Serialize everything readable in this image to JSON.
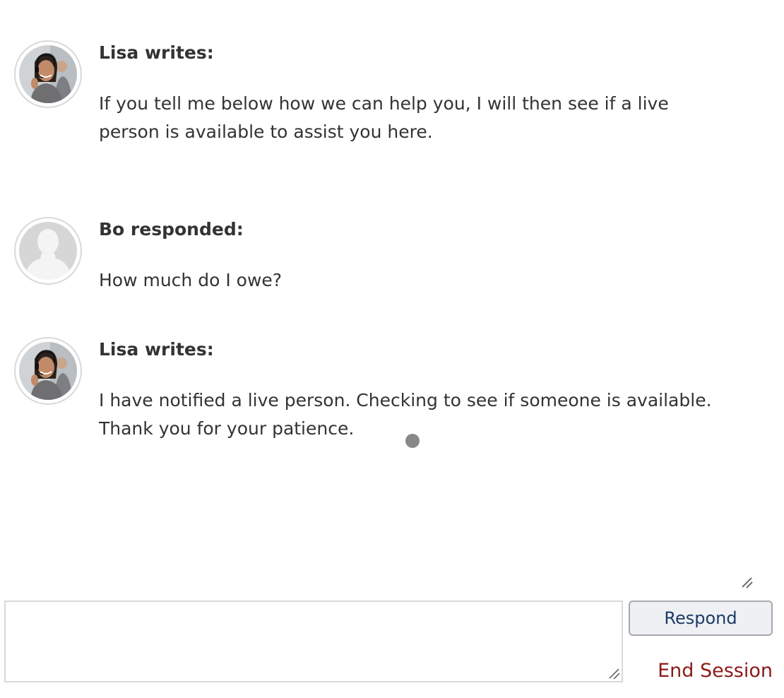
{
  "conversation": {
    "messages": [
      {
        "author": "Lisa writes:",
        "avatar": "agent-headset-photo",
        "text": "If you tell me below how we can help you, I will then see if a live person is available to assist you here."
      },
      {
        "author": "Bo responded:",
        "avatar": "default-user-silhouette",
        "text": "How much do I owe?"
      },
      {
        "author": "Lisa writes:",
        "avatar": "agent-headset-photo",
        "text": "I have notified a live person. Checking to see if someone is available. Thank you for your patience."
      }
    ],
    "typing_indicator": "typing-dot-icon"
  },
  "composer": {
    "value": "",
    "placeholder": "",
    "respond_label": "Respond",
    "end_session_label": "End Session"
  },
  "colors": {
    "text": "#333333",
    "respond_text": "#1d3a66",
    "end_session": "#8b1a1a",
    "button_bg": "#eef0f4",
    "border": "#d9d9d9"
  }
}
